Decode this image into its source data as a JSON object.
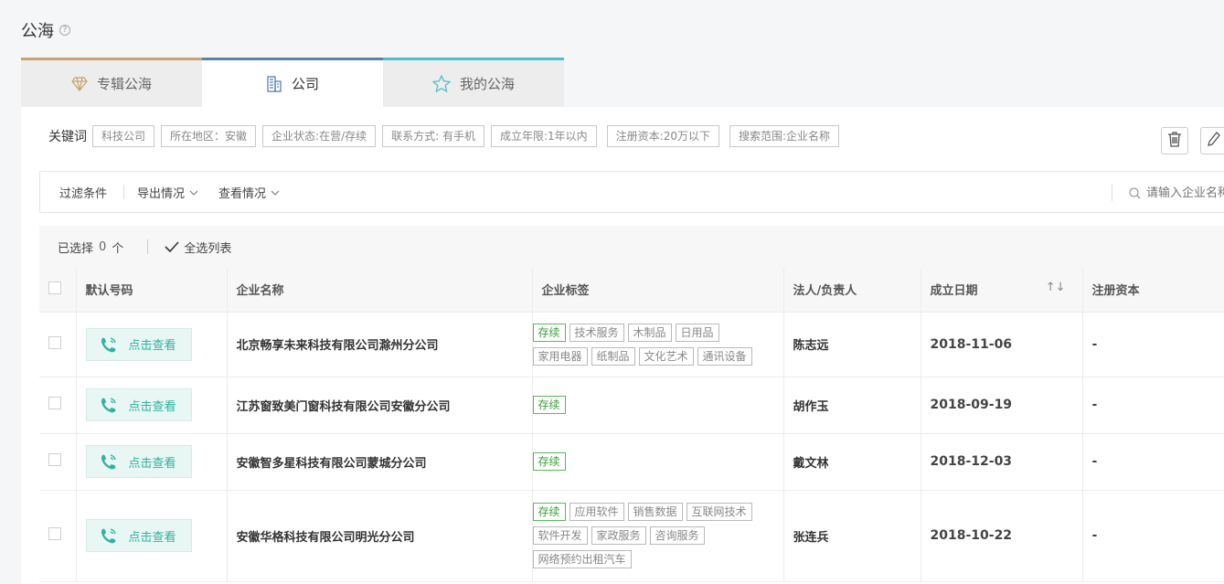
{
  "page": {
    "title": "公海",
    "help_icon": "question-circle-icon"
  },
  "tabs": [
    {
      "label": "专辑公海",
      "icon": "diamond-icon",
      "color": "#c9a26c",
      "active": false
    },
    {
      "label": "公司",
      "icon": "building-icon",
      "color": "#5a81ad",
      "active": true
    },
    {
      "label": "我的公海",
      "icon": "star-icon",
      "color": "#4ec0c5",
      "active": false
    }
  ],
  "keywords": {
    "label": "关键词",
    "tags": [
      "科技公司",
      "所在地区：安徽",
      "企业状态:在营/存续",
      "联系方式: 有手机",
      "成立年限:1年以内",
      "注册资本:20万以下",
      "搜索范围:企业名称"
    ]
  },
  "filter_bar": {
    "filter_label": "过滤条件",
    "export_label": "导出情况",
    "view_label": "查看情况",
    "search_placeholder": "请输入企业名称"
  },
  "selection": {
    "selected_prefix": "已选择",
    "count": "0",
    "unit": "个",
    "select_all_label": "全选列表"
  },
  "table": {
    "headers": [
      "默认号码",
      "企业名称",
      "企业标签",
      "法人/负责人",
      "成立日期",
      "注册资本"
    ],
    "view_label": "点击查看",
    "rows": [
      {
        "name": "北京畅享未来科技有限公司滁州分公司",
        "tags": [
          "存续",
          "技术服务",
          "木制品",
          "日用品",
          "家用电器",
          "纸制品",
          "文化艺术",
          "通讯设备"
        ],
        "person": "陈志远",
        "date": "2018-11-06",
        "capital": "-"
      },
      {
        "name": "江苏窗致美门窗科技有限公司安徽分公司",
        "tags": [
          "存续"
        ],
        "person": "胡作玉",
        "date": "2018-09-19",
        "capital": "-"
      },
      {
        "name": "安徽智多星科技有限公司蒙城分公司",
        "tags": [
          "存续"
        ],
        "person": "戴文林",
        "date": "2018-12-03",
        "capital": "-"
      },
      {
        "name": "安徽华格科技有限公司明光分公司",
        "tags": [
          "存续",
          "应用软件",
          "销售数据",
          "互联网技术",
          "软件开发",
          "家政服务",
          "咨询服务",
          "网络预约出租汽车"
        ],
        "person": "张连兵",
        "date": "2018-10-22",
        "capital": "-"
      }
    ]
  },
  "colors": {
    "accent": "#2db3a0",
    "status_ok": "#5cb85c"
  }
}
